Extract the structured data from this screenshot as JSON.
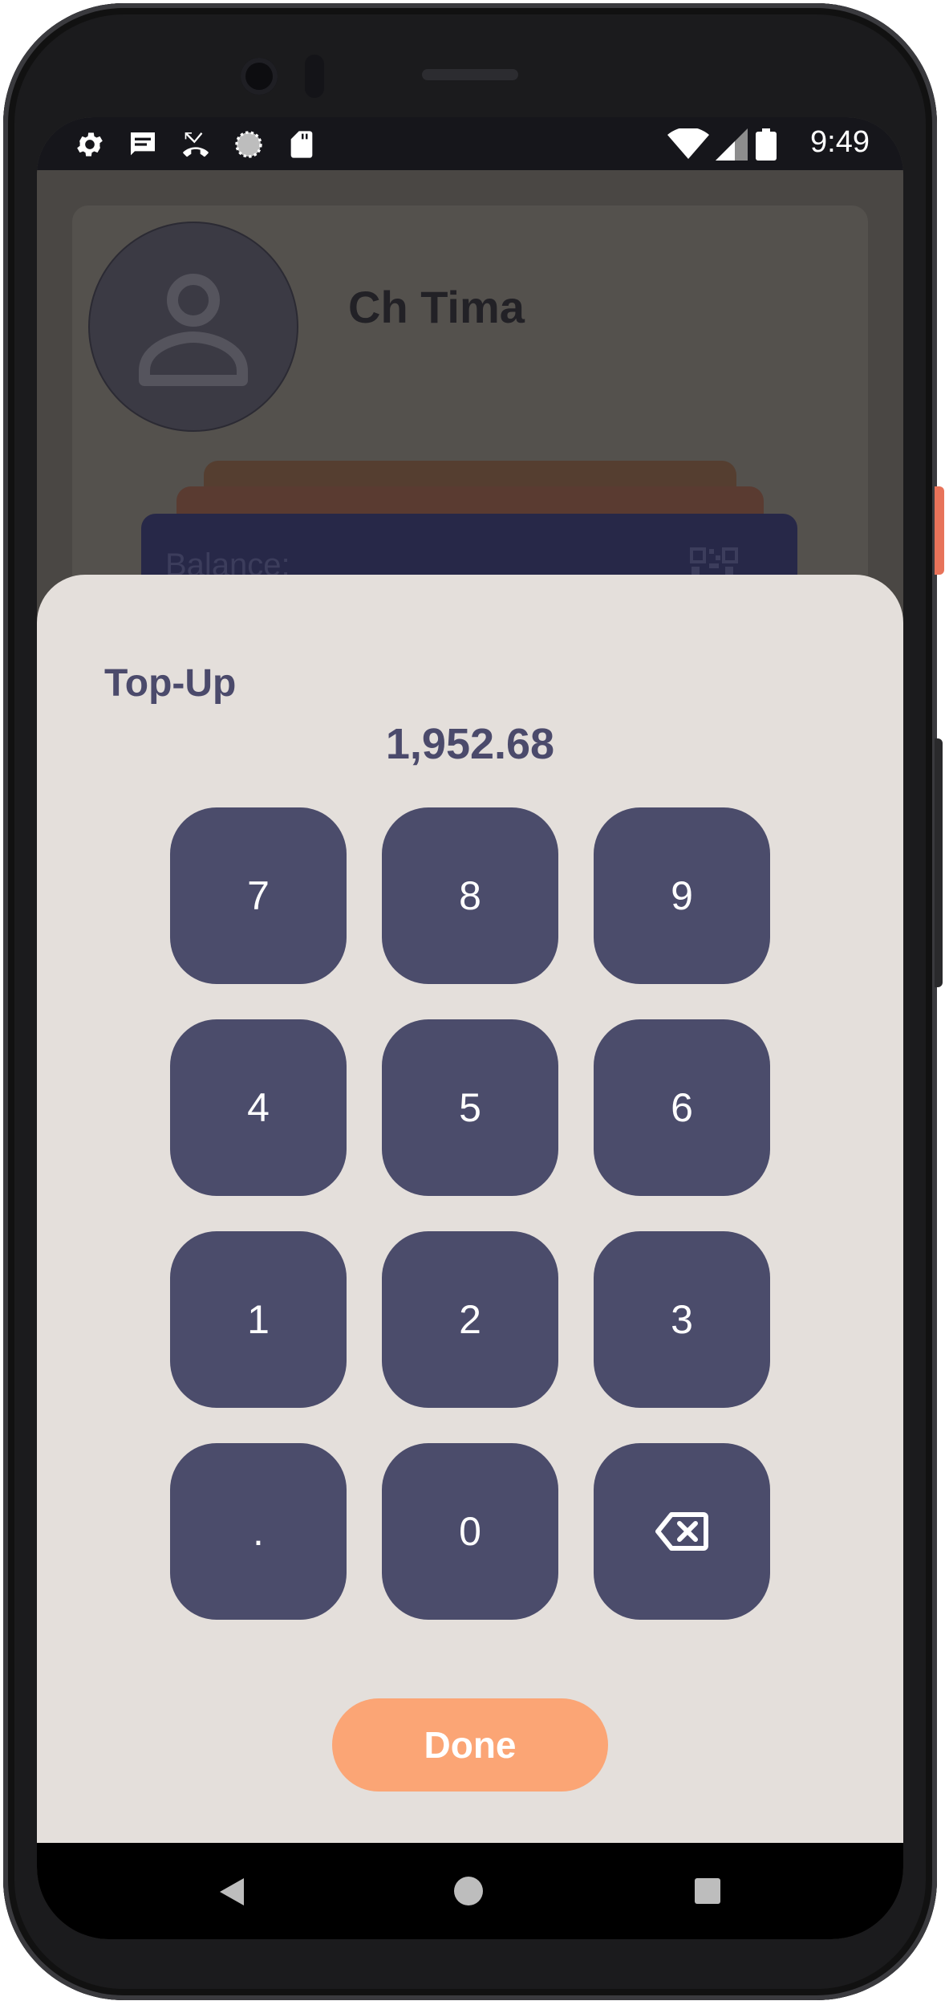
{
  "status_bar": {
    "time": "9:49",
    "left_icons": [
      "gear-icon",
      "message-icon",
      "missed-call-icon",
      "sync-icon",
      "sd-card-icon"
    ],
    "right_icons": [
      "wifi-icon",
      "signal-icon",
      "battery-icon"
    ]
  },
  "profile": {
    "name": "Ch Tima",
    "balance_label": "Balance:"
  },
  "topup_sheet": {
    "title": "Top-Up",
    "amount": "1,952.68",
    "keypad": [
      [
        "7",
        "8",
        "9"
      ],
      [
        "4",
        "5",
        "6"
      ],
      [
        "1",
        "2",
        "3"
      ],
      [
        ".",
        "0",
        "backspace-icon"
      ]
    ],
    "done_label": "Done"
  },
  "colors": {
    "sheet_background": "#e4dfdb",
    "key_background": "#4b4c6b",
    "text_primary": "#4b4a6b",
    "done_button": "#fba575"
  },
  "nav_bar": {
    "buttons": [
      "back-icon",
      "home-icon",
      "recents-icon"
    ]
  }
}
